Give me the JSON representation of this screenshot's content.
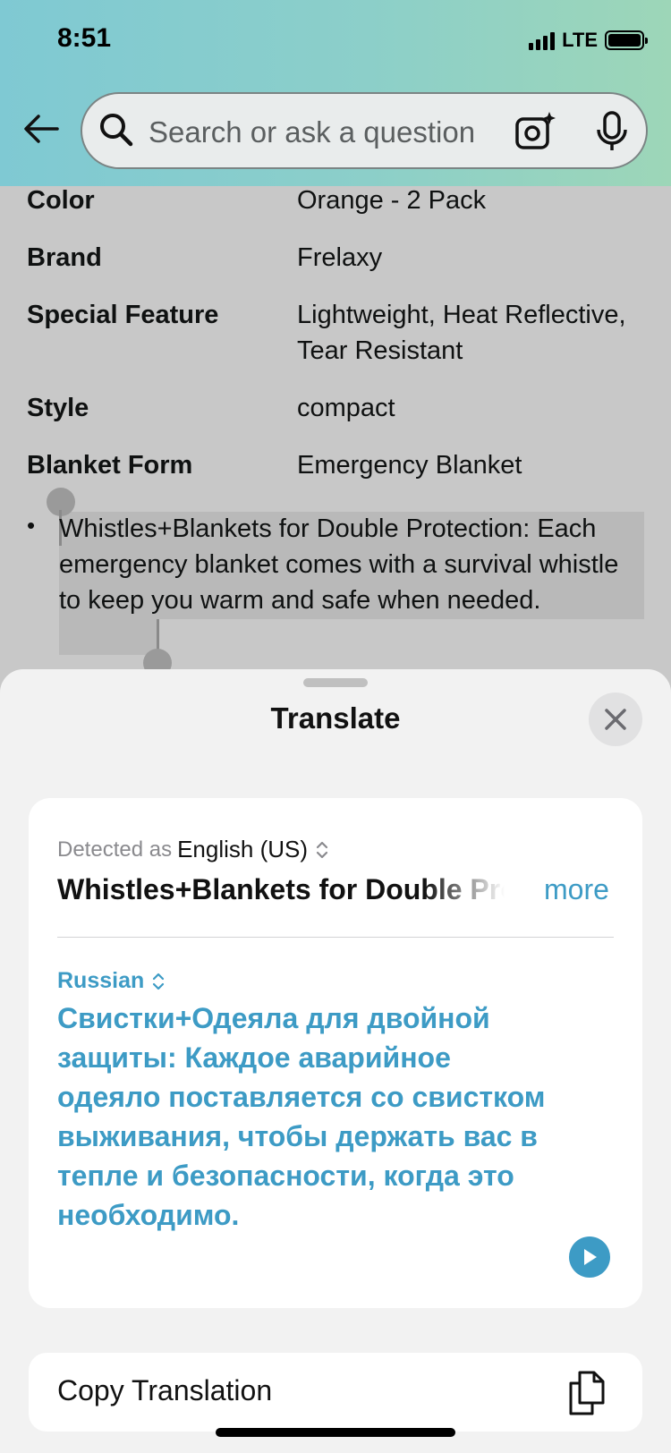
{
  "status_bar": {
    "time": "8:51",
    "network": "LTE"
  },
  "header": {
    "search_placeholder": "Search or ask a question"
  },
  "details": [
    {
      "key": "Color",
      "value": "Orange - 2 Pack"
    },
    {
      "key": "Brand",
      "value": "Frelaxy"
    },
    {
      "key": "Special Feature",
      "value": "Lightweight, Heat Reflective, Tear Resistant"
    },
    {
      "key": "Style",
      "value": "compact"
    },
    {
      "key": "Blanket Form",
      "value": "Emergency Blanket"
    }
  ],
  "bullet": {
    "text": "Whistles+Blankets for Double Protection: Each emergency blanket comes with a survival whistle to keep you warm and safe when needed."
  },
  "translate": {
    "title": "Translate",
    "detected_prefix": "Detected as",
    "detected_language": "English (US)",
    "source_text": "Whistles+Blankets for Double Protection: Each emergency blanket comes with a survival whistle to keep you warm and safe when needed.",
    "more_label": "more",
    "target_language": "Russian",
    "translation": "Свистки+Одеяла для двойной защиты: Каждое аварийное одеяло поставляется со свистком выживания, чтобы держать вас в тепле и безопасности, когда это необходимо.",
    "copy_label": "Copy Translation",
    "accent_color": "#3d9bc5"
  }
}
